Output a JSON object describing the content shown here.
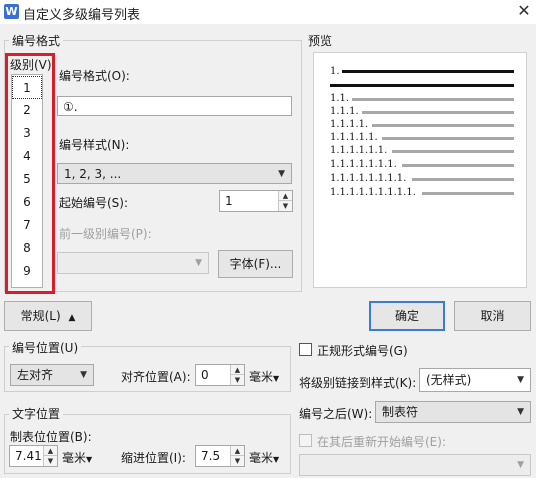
{
  "window": {
    "title": "自定义多级编号列表",
    "app_icon_letter": "W"
  },
  "number_format_group": {
    "label": "编号格式"
  },
  "level": {
    "label": "级别(V)",
    "items": [
      "1",
      "2",
      "3",
      "4",
      "5",
      "6",
      "7",
      "8",
      "9"
    ],
    "selected": "1"
  },
  "format_field": {
    "label": "编号格式(O):",
    "value": "①."
  },
  "style_field": {
    "label": "编号样式(N):",
    "value": "1, 2, 3, ..."
  },
  "start_field": {
    "label": "起始编号(S):",
    "value": "1"
  },
  "prev_level": {
    "label": "前一级别编号(P):",
    "value": ""
  },
  "font_button": {
    "label": "字体(F)..."
  },
  "preview": {
    "label": "预览",
    "rows": [
      "1.",
      "1.1.",
      "1.1.1.",
      "1.1.1.1.",
      "1.1.1.1.1.",
      "1.1.1.1.1.1.",
      "1.1.1.1.1.1.1.",
      "1.1.1.1.1.1.1.1.",
      "1.1.1.1.1.1.1.1.1."
    ]
  },
  "buttons": {
    "general": "常规(L)",
    "ok": "确定",
    "cancel": "取消"
  },
  "number_position": {
    "label": "编号位置(U)",
    "align_value": "左对齐",
    "align_pos_label": "对齐位置(A):",
    "align_pos_value": "0",
    "unit": "毫米"
  },
  "text_position": {
    "label": "文字位置",
    "tab_label": "制表位位置(B):",
    "tab_value": "7.41",
    "tab_unit": "毫米",
    "indent_label": "缩进位置(I):",
    "indent_value": "7.5",
    "indent_unit": "毫米"
  },
  "right_options": {
    "legal_label": "正规形式编号(G)",
    "link_label": "将级别链接到样式(K):",
    "link_value": "(无样式)",
    "after_label": "编号之后(W):",
    "after_value": "制表符",
    "restart_label": "在其后重新开始编号(E):",
    "restart_value": ""
  }
}
